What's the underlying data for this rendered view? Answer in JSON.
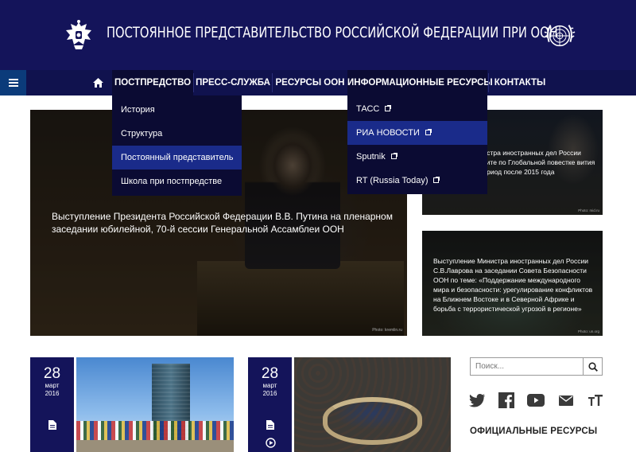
{
  "header": {
    "title": "ПОСТОЯННОЕ ПРЕДСТАВИТЕЛЬСТВО РОССИЙСКОЙ ФЕДЕРАЦИИ ПРИ ООН",
    "emblem_left_icon": "russian-coat-of-arms-icon",
    "emblem_right_icon": "un-emblem-icon"
  },
  "nav": {
    "menu_icon": "hamburger-icon",
    "home_icon": "home-icon",
    "items": [
      {
        "label": "ПОСТПРЕДСТВО"
      },
      {
        "label": "ПРЕСС-СЛУЖБА"
      },
      {
        "label": "РЕСУРСЫ ООН"
      },
      {
        "label": "ИНФОРМАЦИОННЫЕ РЕСУРСЫ"
      },
      {
        "label": "КОНТАКТЫ"
      }
    ]
  },
  "dropdown_mission": {
    "items": [
      {
        "label": "История"
      },
      {
        "label": "Структура"
      },
      {
        "label": "Постоянный представитель"
      },
      {
        "label": "Школа при постпредстве"
      }
    ]
  },
  "dropdown_info": {
    "items": [
      {
        "label": "ТАСС"
      },
      {
        "label": "РИА НОВОСТИ"
      },
      {
        "label": "Sputnik"
      },
      {
        "label": "RT (Russia Today)"
      }
    ]
  },
  "hero": {
    "caption": "Выступление Президента Российской Федерации В.В. Путина на пленарном заседании юбилейной, 70-й сессии Генеральной Ассамблеи ООН",
    "credit": "Photo: kremlin.ru"
  },
  "cards": [
    {
      "text": "Министра иностранных дел России саммите по Глобальной повестке вития на период после 2015 года",
      "credit": "Photo: mid.ru"
    },
    {
      "text": "Выступление Министра иностранных дел России С.В.Лаврова на заседании Совета Безопасности ООН по теме: «Поддержание международного мира и безопасности: урегулирование конфликтов на Ближнем Востоке и в Северной Африке и борьба с террористической угрозой в регионе»",
      "credit": "Photo: un.org"
    }
  ],
  "news": [
    {
      "day": "28",
      "month": "март",
      "year": "2016",
      "icons": [
        "document-icon"
      ]
    },
    {
      "day": "28",
      "month": "март",
      "year": "2016",
      "icons": [
        "document-icon",
        "play-icon"
      ]
    }
  ],
  "search": {
    "placeholder": "Поиск...",
    "icon": "search-icon"
  },
  "social": [
    "twitter-icon",
    "facebook-icon",
    "youtube-icon",
    "mail-icon",
    "font-size-icon"
  ],
  "sidebar": {
    "resources_title": "ОФИЦИАЛЬНЫЕ РЕСУРСЫ"
  },
  "colors": {
    "header_bg": "#14145a",
    "nav_bg": "#10124e",
    "dropdown_bg": "#0b0b33",
    "dropdown_hover": "#1a2b8a",
    "accent": "#0b3b7a"
  }
}
